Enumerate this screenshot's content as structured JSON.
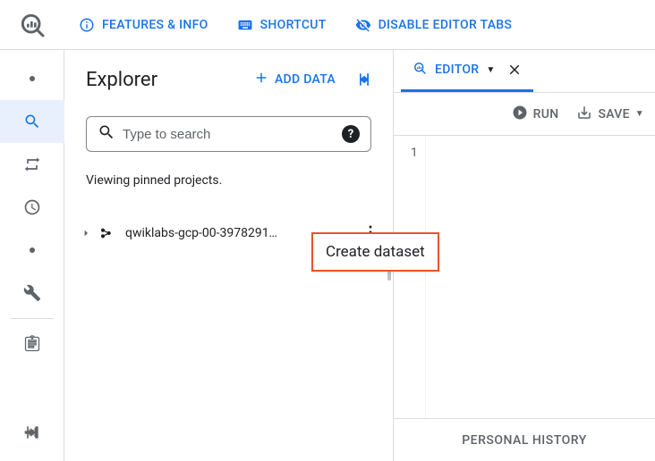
{
  "top": {
    "features": "FEATURES & INFO",
    "shortcut": "SHORTCUT",
    "disable_tabs": "DISABLE EDITOR TABS"
  },
  "explorer": {
    "title": "Explorer",
    "add_data": "ADD DATA",
    "search_placeholder": "Type to search",
    "pinned_text": "Viewing pinned projects.",
    "project_name": "qwiklabs-gcp-00-3978291…"
  },
  "popup": {
    "create_dataset": "Create dataset"
  },
  "editor": {
    "tab_label": "EDITOR",
    "run": "RUN",
    "save": "SAVE",
    "line_number": "1",
    "personal_history": "PERSONAL HISTORY"
  }
}
